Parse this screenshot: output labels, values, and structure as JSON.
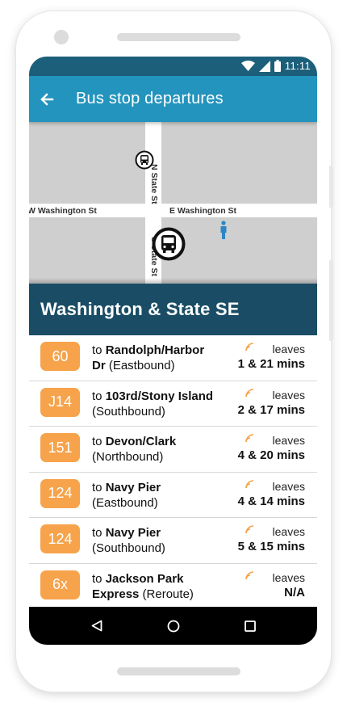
{
  "status": {
    "time": "11:11"
  },
  "appbar": {
    "title": "Bus stop departures",
    "back_icon": "arrow-left-icon"
  },
  "map": {
    "street_west": "W Washington St",
    "street_east": "E Washington St",
    "street_north": "N State St",
    "street_south": "S State St"
  },
  "stop": {
    "name": "Washington & State SE"
  },
  "departures": [
    {
      "route": "60",
      "to_prefix": "to",
      "destination": "Randolph/Harbor Dr",
      "direction": "(Eastbound)",
      "leaves_label": "leaves",
      "eta": "1 & 21 mins"
    },
    {
      "route": "J14",
      "to_prefix": "to",
      "destination": "103rd/Stony Island",
      "direction": "(Southbound)",
      "leaves_label": "leaves",
      "eta": "2 & 17 mins"
    },
    {
      "route": "151",
      "to_prefix": "to",
      "destination": "Devon/Clark",
      "direction": "(Northbound)",
      "leaves_label": "leaves",
      "eta": "4 & 20 mins"
    },
    {
      "route": "124",
      "to_prefix": "to",
      "destination": "Navy Pier",
      "direction": "(Eastbound)",
      "leaves_label": "leaves",
      "eta": "4 & 14 mins"
    },
    {
      "route": "124",
      "to_prefix": "to",
      "destination": "Navy Pier",
      "direction": "(Southbound)",
      "leaves_label": "leaves",
      "eta": "5 & 15 mins"
    },
    {
      "route": "6x",
      "to_prefix": "to",
      "destination": "Jackson Park Express",
      "direction": "(Reroute)",
      "leaves_label": "leaves",
      "eta": "N/A"
    }
  ],
  "colors": {
    "status_bar": "#1c5f7a",
    "app_bar": "#2394bd",
    "stop_header": "#1a4d65",
    "route_badge": "#f6a34b"
  },
  "navbar": {
    "back_icon": "triangle-back-icon",
    "home_icon": "circle-home-icon",
    "recents_icon": "square-recents-icon"
  }
}
